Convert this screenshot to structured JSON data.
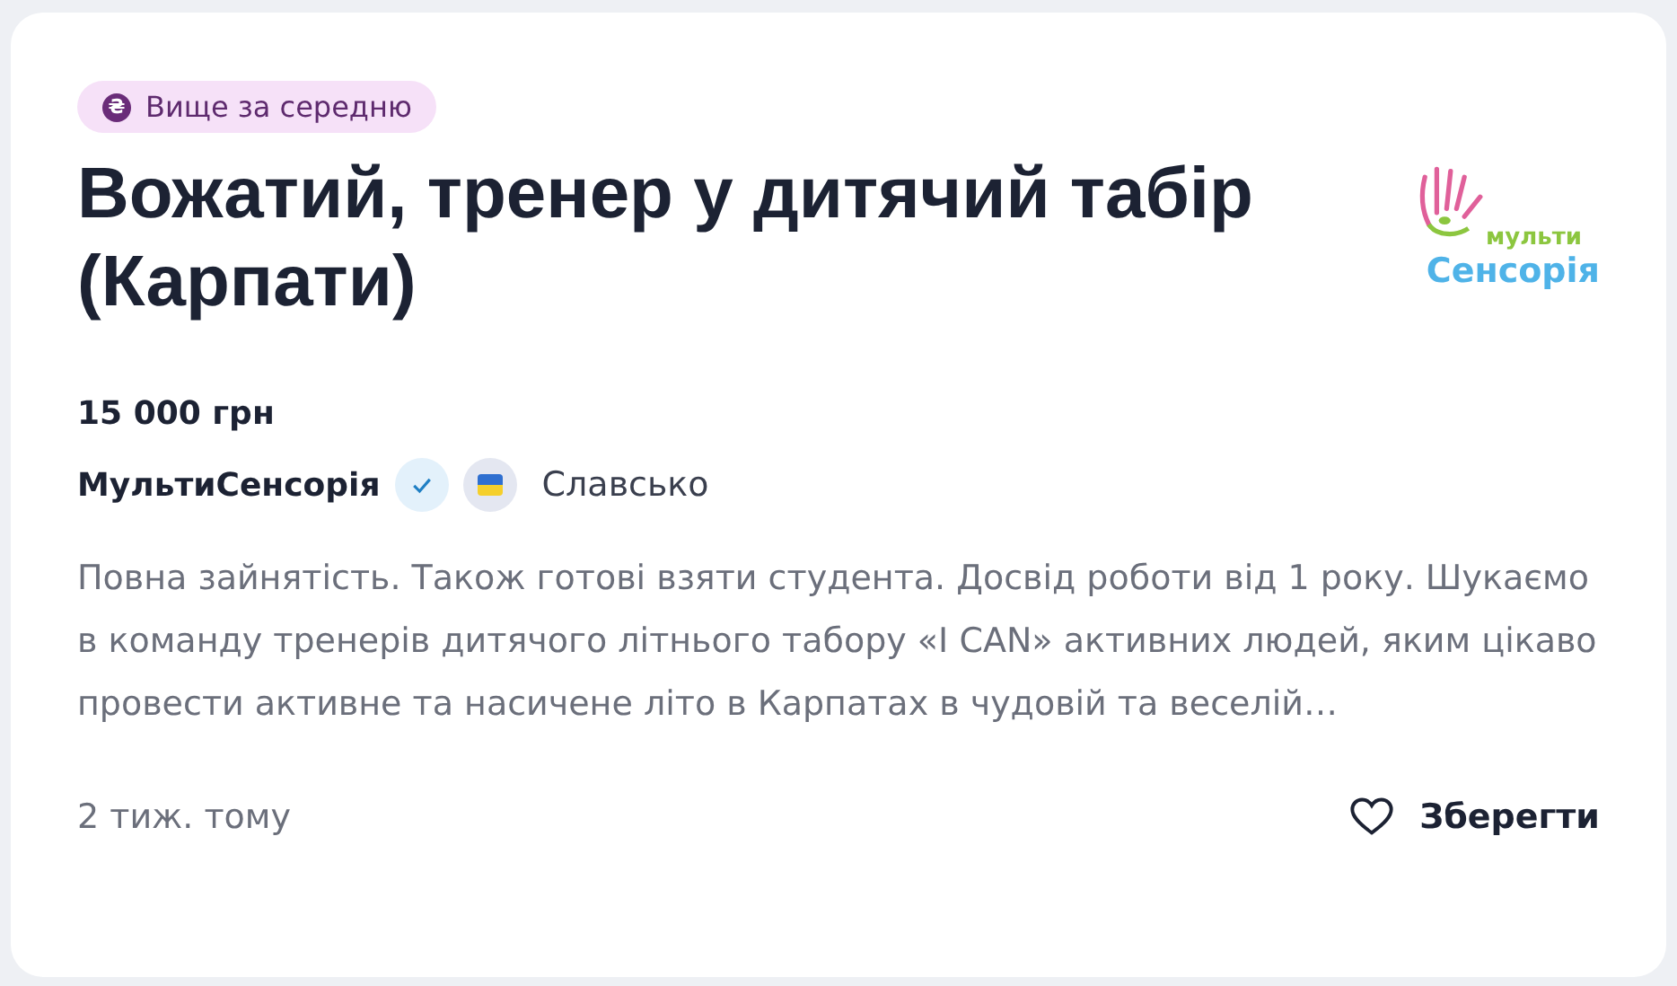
{
  "badge": {
    "icon": "₴",
    "label": "Вище за середню"
  },
  "title": "Вожатий, тренер у дитячий табір (Карпати)",
  "logo": {
    "line1": "мульти",
    "line2": "Сенсорія"
  },
  "salary": "15 000 грн",
  "company": {
    "name": "МультиСенсорія",
    "verified": true
  },
  "location": "Славсько",
  "description": "Повна зайнятість. Також готові взяти студента. Досвід роботи від 1 року. Шукаємо в команду тренерів дитячого літнього табору «I CAN» активних людей, яким цікаво провести активне та насичене літо в Карпатах в чудовій та веселій…",
  "posted": "2 тиж. тому",
  "save": {
    "label": "Зберегти",
    "saved": false
  }
}
